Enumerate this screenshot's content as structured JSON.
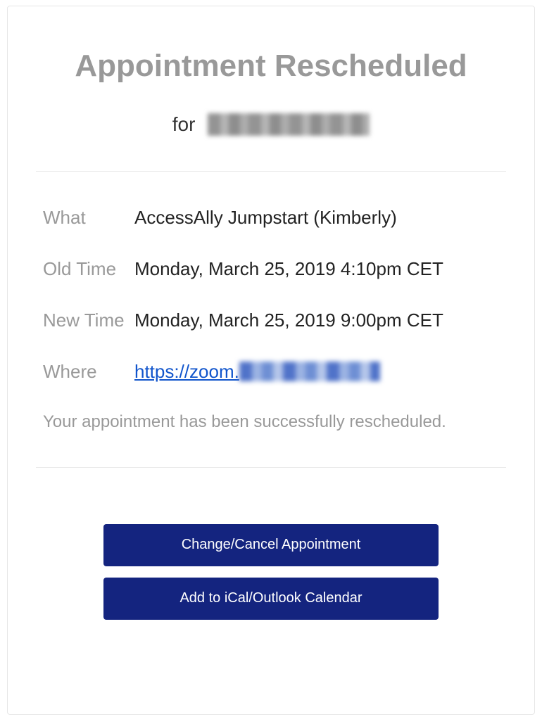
{
  "title": "Appointment Rescheduled",
  "for_label": "for",
  "details": {
    "what_label": "What",
    "what_value": "AccessAlly Jumpstart (Kimberly)",
    "old_time_label": "Old Time",
    "old_time_value": "Monday, March 25, 2019 4:10pm CET",
    "new_time_label": "New Time",
    "new_time_value": "Monday, March 25, 2019 9:00pm CET",
    "where_label": "Where",
    "where_link_visible": "https://zoom."
  },
  "confirmation": "Your appointment has been successfully rescheduled.",
  "buttons": {
    "change_cancel": "Change/Cancel Appointment",
    "add_calendar": "Add to iCal/Outlook Calendar"
  }
}
